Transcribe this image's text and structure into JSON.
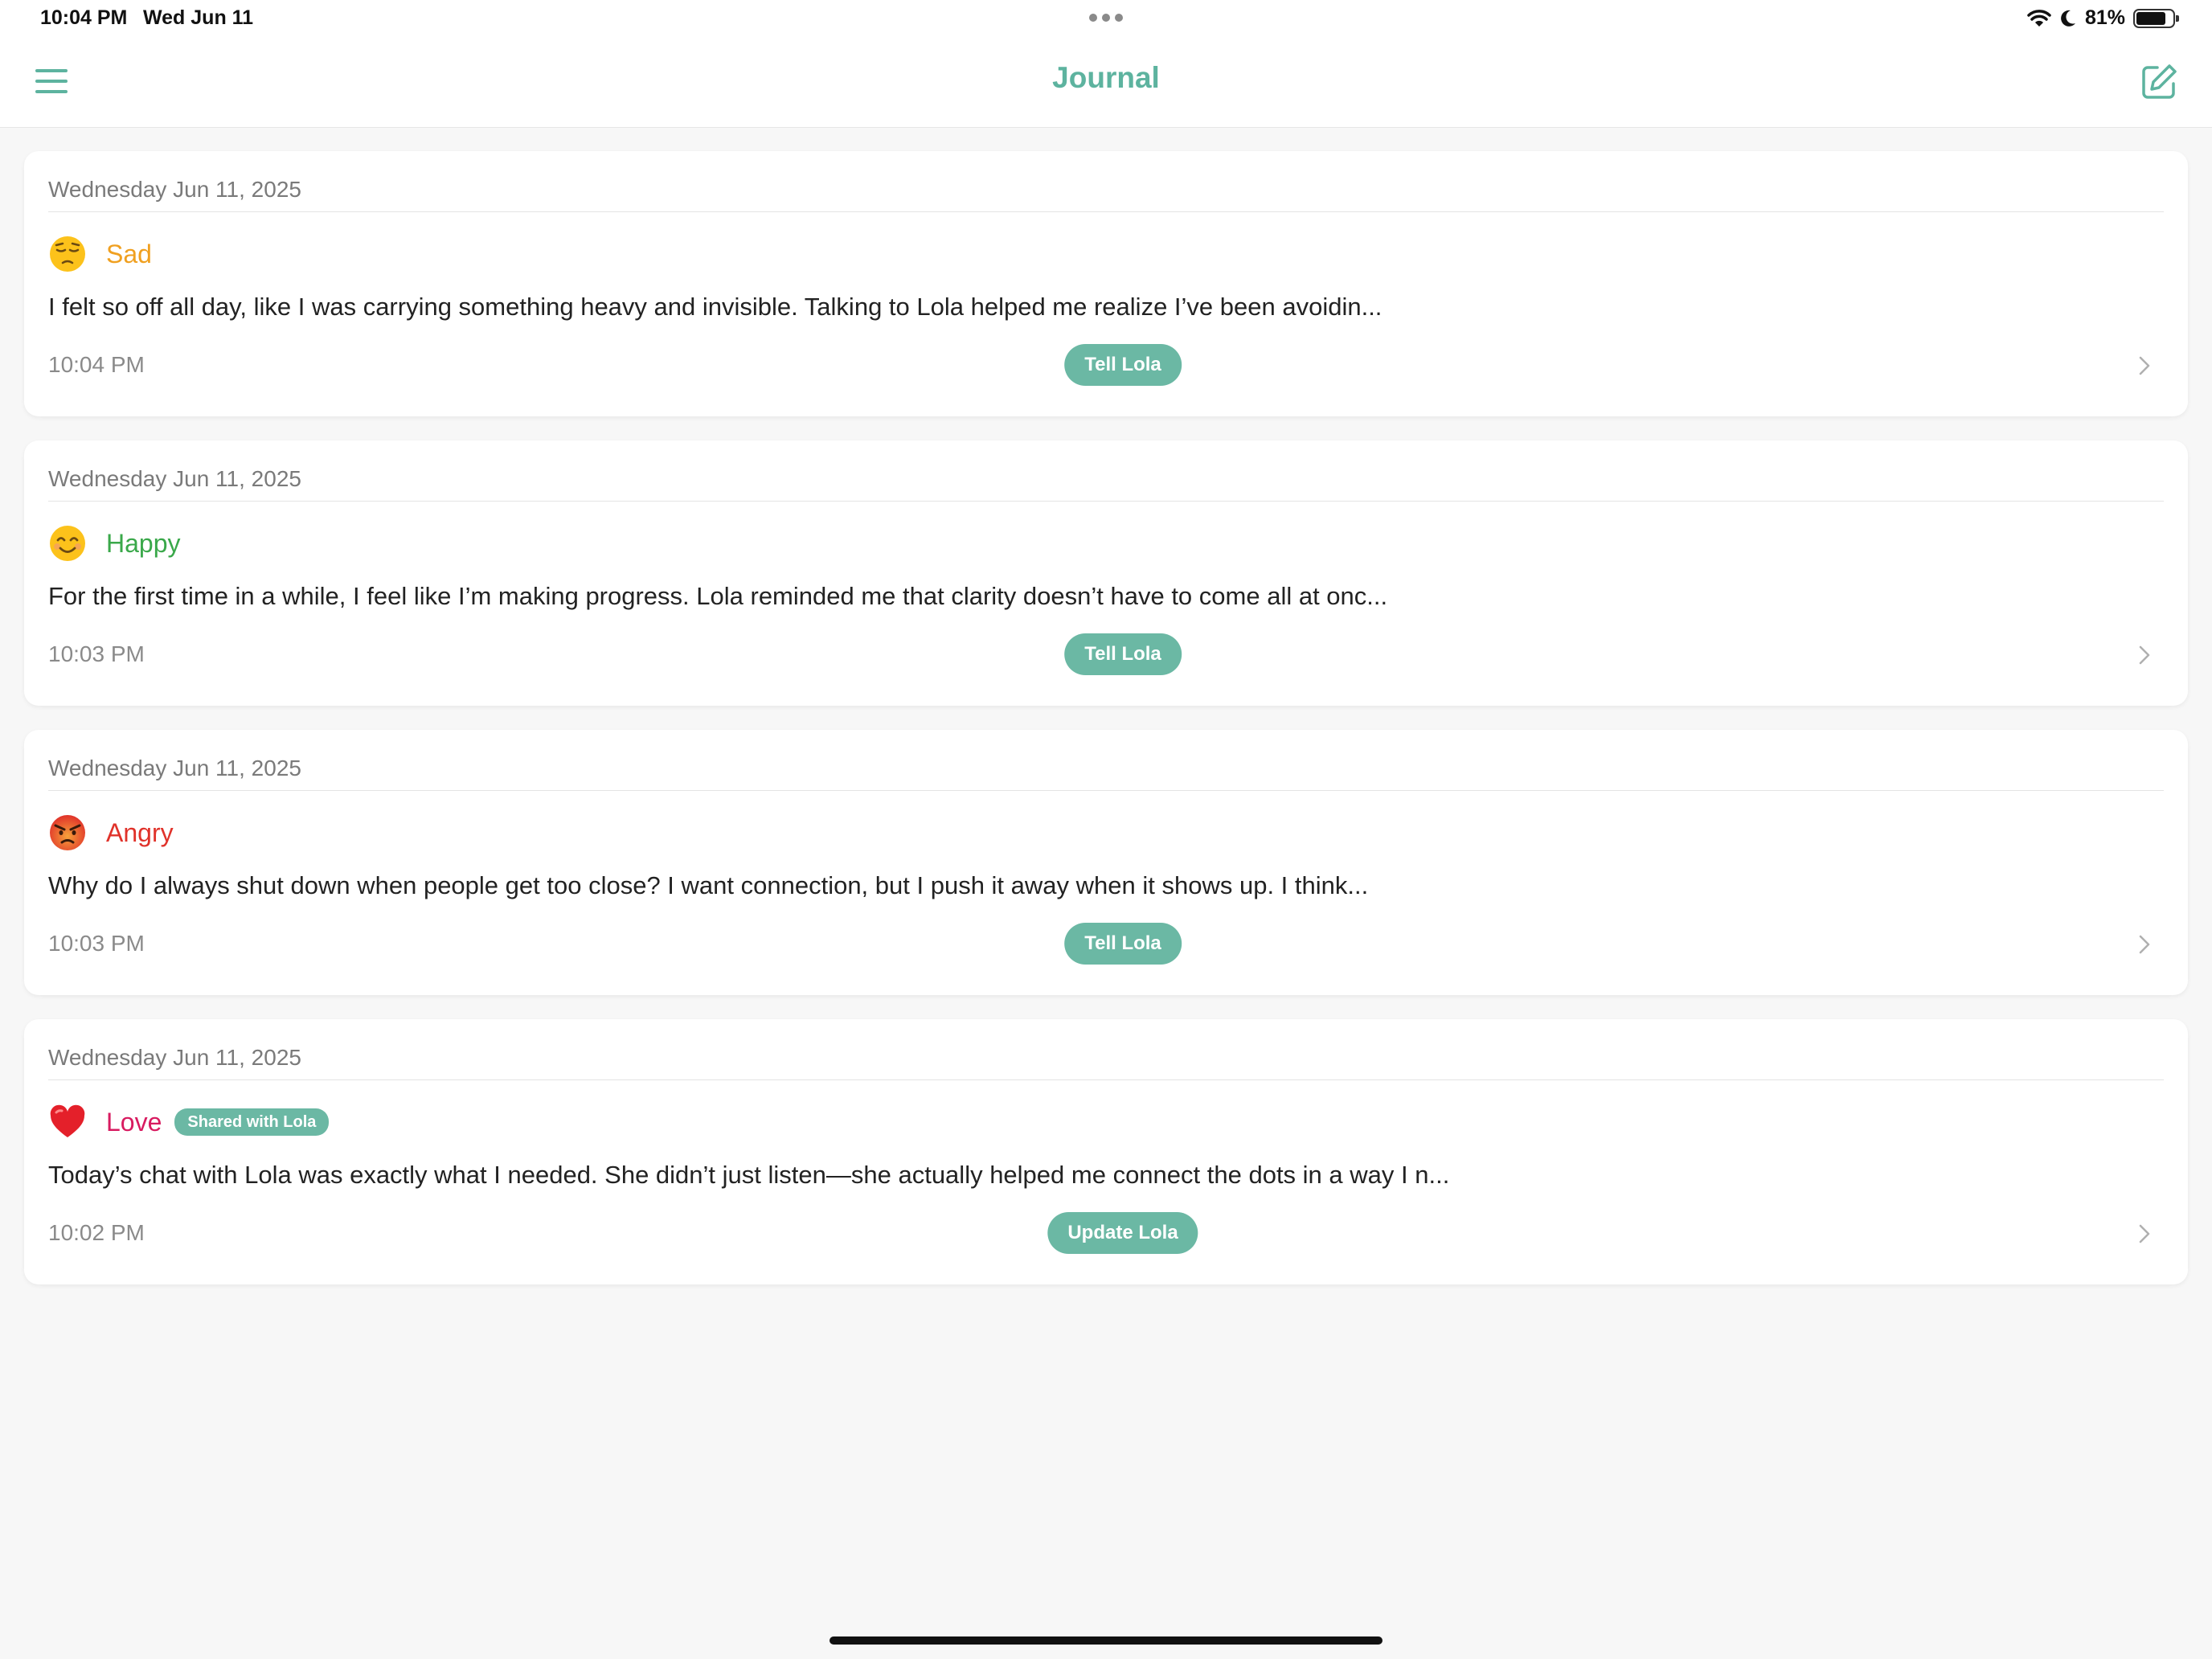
{
  "status_bar": {
    "time": "10:04 PM",
    "date": "Wed Jun 11",
    "battery_text": "81%",
    "battery_level": 0.81
  },
  "nav": {
    "title": "Journal",
    "menu_icon": "hamburger-menu-icon",
    "compose_icon": "compose-edit-icon"
  },
  "colors": {
    "accent": "#5db39f",
    "button": "#6bb8a4",
    "sad": "#f0a020",
    "happy": "#3aa84a",
    "angry": "#e0322a",
    "love": "#d81b60"
  },
  "entries": [
    {
      "date": "Wednesday Jun 11, 2025",
      "mood": "Sad",
      "emoji": "pensive-face-icon",
      "shared_badge": "",
      "text": "I felt so off all day, like I was carrying something heavy and invisible. Talking to Lola helped me realize I’ve been avoidin...",
      "time": "10:04 PM",
      "button_label": "Tell Lola"
    },
    {
      "date": "Wednesday Jun 11, 2025",
      "mood": "Happy",
      "emoji": "smiling-face-icon",
      "shared_badge": "",
      "text": "For the first time in a while, I feel like I’m making progress. Lola reminded me that clarity doesn’t have to come all at onc...",
      "time": "10:03 PM",
      "button_label": "Tell Lola"
    },
    {
      "date": "Wednesday Jun 11, 2025",
      "mood": "Angry",
      "emoji": "angry-face-icon",
      "shared_badge": "",
      "text": "Why do I always shut down when people get too close? I want connection, but I push it away when it shows up. I think...",
      "time": "10:03 PM",
      "button_label": "Tell Lola"
    },
    {
      "date": "Wednesday Jun 11, 2025",
      "mood": "Love",
      "emoji": "red-heart-icon",
      "shared_badge": "Shared with Lola",
      "text": "Today’s chat with Lola was exactly what I needed. She didn’t just listen—she actually helped me connect the dots in a way I n...",
      "time": "10:02 PM",
      "button_label": "Update Lola"
    }
  ]
}
